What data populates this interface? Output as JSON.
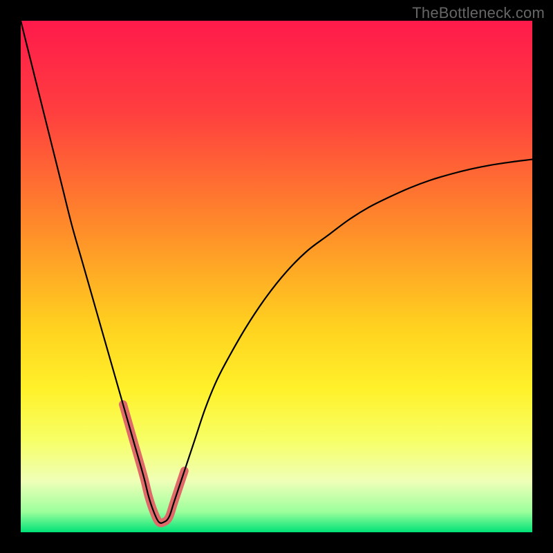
{
  "watermark": "TheBottleneck.com",
  "chart_data": {
    "type": "line",
    "title": "",
    "xlabel": "",
    "ylabel": "",
    "xlim": [
      0,
      100
    ],
    "ylim": [
      0,
      100
    ],
    "gradient_stops": [
      {
        "offset": 0.0,
        "color": "#ff1a4b"
      },
      {
        "offset": 0.18,
        "color": "#ff3f3f"
      },
      {
        "offset": 0.4,
        "color": "#ff8a2a"
      },
      {
        "offset": 0.6,
        "color": "#ffd21f"
      },
      {
        "offset": 0.72,
        "color": "#fff12a"
      },
      {
        "offset": 0.82,
        "color": "#f7ff66"
      },
      {
        "offset": 0.9,
        "color": "#efffb7"
      },
      {
        "offset": 0.96,
        "color": "#9cff9c"
      },
      {
        "offset": 1.0,
        "color": "#00e277"
      }
    ],
    "series": [
      {
        "name": "bottleneck-curve",
        "stroke": "#000000",
        "stroke_width": 2.2,
        "x": [
          0,
          2,
          4,
          6,
          8,
          10,
          12,
          14,
          16,
          18,
          20,
          22,
          24,
          25,
          26,
          27,
          28,
          29,
          30,
          32,
          34,
          36,
          38,
          40,
          44,
          48,
          52,
          56,
          60,
          64,
          68,
          72,
          76,
          80,
          84,
          88,
          92,
          96,
          100
        ],
        "values": [
          100,
          92,
          84,
          76,
          68,
          60,
          53,
          46,
          39,
          32,
          25,
          18,
          11,
          7,
          4,
          2,
          2,
          3,
          6,
          12,
          18,
          24,
          29,
          33,
          40,
          46,
          51,
          55,
          58,
          61,
          63.5,
          65.5,
          67.3,
          68.8,
          70.0,
          71.0,
          71.8,
          72.4,
          72.9
        ]
      },
      {
        "name": "minimum-highlight",
        "stroke": "#e06a6a",
        "stroke_width": 12,
        "x": [
          20,
          22,
          24,
          25,
          26,
          27,
          28,
          29,
          30,
          32
        ],
        "values": [
          25,
          18,
          11,
          7,
          4,
          2,
          2,
          3,
          6,
          12
        ]
      }
    ]
  }
}
